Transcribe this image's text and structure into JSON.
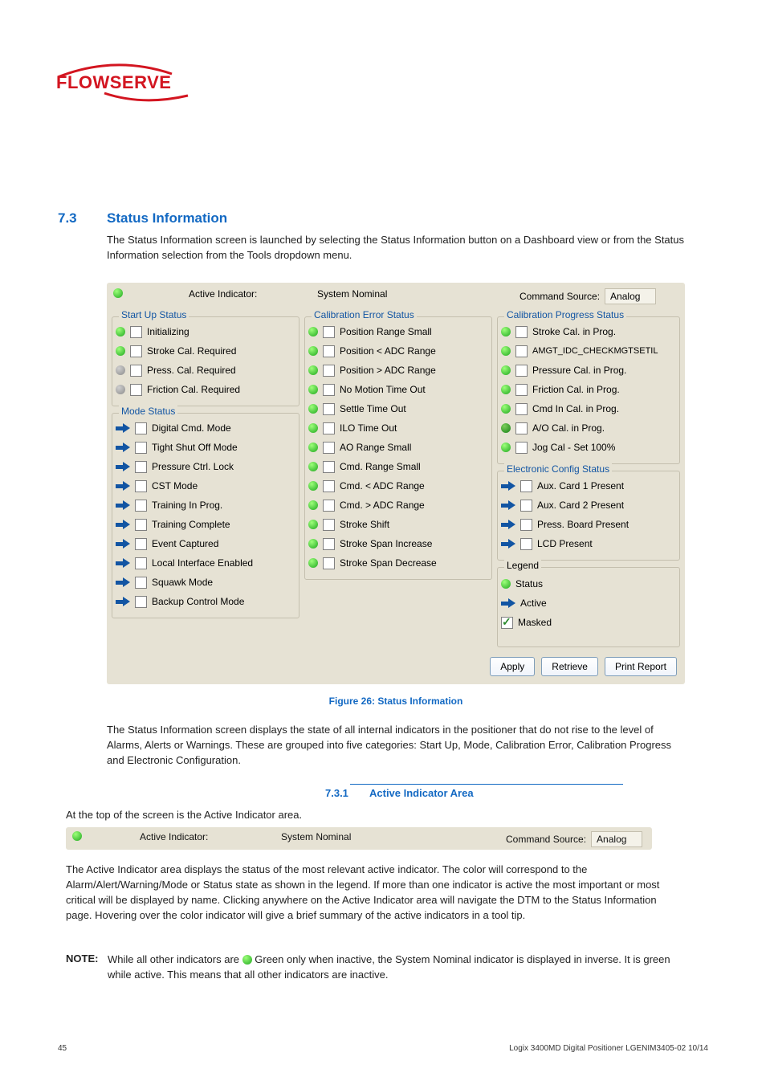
{
  "logo_text": "FLOWSERVE",
  "section_number": "7.3",
  "section_title": "Status Information",
  "intro": "The Status Information screen is launched by selecting the Status Information button on a Dashboard view or from the Status Information selection from the Tools dropdown menu.",
  "header": {
    "active_indicator_label": "Active Indicator:",
    "active_indicator_value": "System Nominal",
    "command_source_label": "Command Source:",
    "command_source_value": "Analog"
  },
  "groups": {
    "startup": {
      "title": "Start Up Status",
      "items": [
        {
          "icon": "dot-green",
          "chk": false,
          "label": "Initializing"
        },
        {
          "icon": "dot-green",
          "chk": false,
          "label": "Stroke Cal. Required"
        },
        {
          "icon": "dot-grey",
          "chk": false,
          "label": "Press. Cal. Required"
        },
        {
          "icon": "dot-grey",
          "chk": false,
          "label": "Friction Cal. Required"
        }
      ]
    },
    "mode": {
      "title": "Mode Status",
      "items": [
        {
          "icon": "arrow",
          "chk": false,
          "label": "Digital Cmd. Mode"
        },
        {
          "icon": "arrow",
          "chk": false,
          "label": "Tight Shut Off Mode"
        },
        {
          "icon": "arrow",
          "chk": false,
          "label": "Pressure Ctrl. Lock"
        },
        {
          "icon": "arrow",
          "chk": false,
          "label": "CST Mode"
        },
        {
          "icon": "arrow",
          "chk": false,
          "label": "Training In Prog."
        },
        {
          "icon": "arrow",
          "chk": false,
          "label": "Training Complete"
        },
        {
          "icon": "arrow",
          "chk": false,
          "label": "Event Captured"
        },
        {
          "icon": "arrow",
          "chk": false,
          "label": "Local Interface Enabled"
        },
        {
          "icon": "arrow",
          "chk": false,
          "label": "Squawk Mode"
        },
        {
          "icon": "arrow",
          "chk": false,
          "label": "Backup Control Mode"
        }
      ]
    },
    "calerr": {
      "title": "Calibration Error Status",
      "items": [
        {
          "icon": "dot-green",
          "chk": false,
          "label": "Position Range Small"
        },
        {
          "icon": "dot-green",
          "chk": false,
          "label": "Position < ADC Range"
        },
        {
          "icon": "dot-green",
          "chk": false,
          "label": "Position > ADC Range"
        },
        {
          "icon": "dot-green",
          "chk": false,
          "label": "No Motion Time Out"
        },
        {
          "icon": "dot-green",
          "chk": false,
          "label": "Settle Time Out"
        },
        {
          "icon": "dot-green",
          "chk": false,
          "label": "ILO Time Out"
        },
        {
          "icon": "dot-green",
          "chk": false,
          "label": "AO Range Small"
        },
        {
          "icon": "dot-green",
          "chk": false,
          "label": "Cmd. Range Small"
        },
        {
          "icon": "dot-green",
          "chk": false,
          "label": "Cmd. < ADC Range"
        },
        {
          "icon": "dot-green",
          "chk": false,
          "label": "Cmd. > ADC Range"
        },
        {
          "icon": "dot-green",
          "chk": false,
          "label": "Stroke Shift"
        },
        {
          "icon": "dot-green",
          "chk": false,
          "label": "Stroke Span Increase"
        },
        {
          "icon": "dot-green",
          "chk": false,
          "label": "Stroke Span Decrease"
        }
      ]
    },
    "calprog": {
      "title": "Calibration Progress Status",
      "items": [
        {
          "icon": "dot-green",
          "chk": false,
          "label": "Stroke Cal. in Prog."
        },
        {
          "icon": "dot-green",
          "chk": false,
          "label": "AMGT_IDC_CHECKMGTSETIL"
        },
        {
          "icon": "dot-green",
          "chk": false,
          "label": "Pressure Cal. in Prog."
        },
        {
          "icon": "dot-green",
          "chk": false,
          "label": "Friction Cal. in Prog."
        },
        {
          "icon": "dot-green",
          "chk": false,
          "label": "Cmd In Cal. in Prog."
        },
        {
          "icon": "dot-dgreen",
          "chk": false,
          "label": "A/O Cal. in Prog."
        },
        {
          "icon": "dot-green",
          "chk": false,
          "label": "Jog Cal - Set 100%"
        }
      ]
    },
    "econf": {
      "title": "Electronic Config Status",
      "items": [
        {
          "icon": "arrow",
          "chk": false,
          "label": "Aux. Card 1 Present"
        },
        {
          "icon": "arrow",
          "chk": false,
          "label": "Aux. Card 2 Present"
        },
        {
          "icon": "arrow",
          "chk": false,
          "label": "Press. Board Present"
        },
        {
          "icon": "arrow",
          "chk": false,
          "label": "LCD Present"
        }
      ]
    },
    "legend": {
      "title": "Legend",
      "status": "Status",
      "active": "Active",
      "masked": "Masked"
    }
  },
  "buttons": {
    "apply": "Apply",
    "retrieve": "Retrieve",
    "print": "Print Report"
  },
  "figure_caption": "Figure 26: Status Information",
  "sub_number": "7.3.1",
  "sub_title": "Active Indicator Area",
  "sub_body": "The Active Indicator area displays the status of the most relevant active indicator. The color will correspond to the Alarm/Alert/Warning/Mode or Status state as shown in the legend. If more than one indicator is active the most important or most critical will be displayed by name. Clicking anywhere on the Active Indicator area will navigate the DTM to the Status Information page. Hovering over the color indicator will give a brief summary of the active indicators in a tool tip.",
  "note_label": "NOTE:",
  "note_body_1": "While all other indicators are ",
  "note_body_2": " Green only when inactive, the System Nominal indicator is displayed in inverse. It is green while active. This means that all other indicators are inactive.",
  "footer": {
    "left": "45",
    "right": "Logix 3400MD Digital Positioner LGENIM3405-02 10/14"
  }
}
